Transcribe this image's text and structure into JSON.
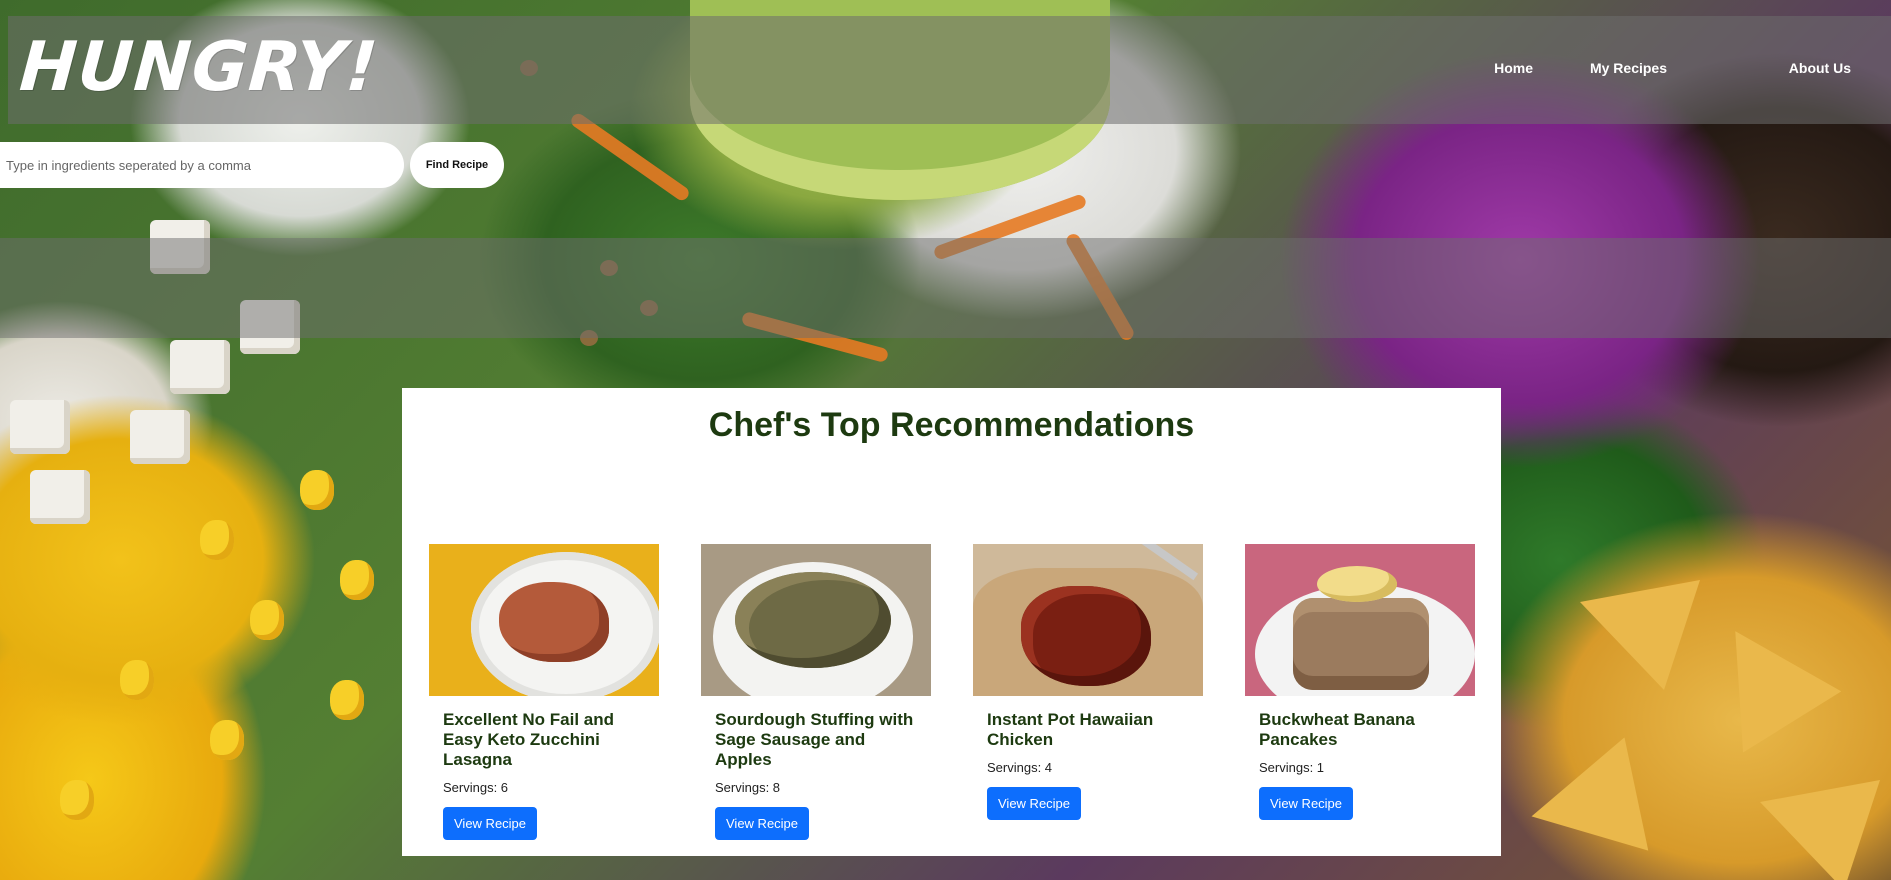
{
  "site": {
    "logo": "HUNGRY!"
  },
  "nav": {
    "items": [
      "Home",
      "My Recipes",
      "About Us"
    ]
  },
  "search": {
    "placeholder": "Type in ingredients seperated by a comma",
    "button_label": "Find Recipe"
  },
  "recommendations": {
    "title": "Chef's Top Recommendations",
    "cards": [
      {
        "title": "Excellent No Fail and Easy Keto Zucchini Lasagna",
        "servings": "Servings: 6",
        "button": "View Recipe",
        "image": "lasagna-plate-image"
      },
      {
        "title": "Sourdough Stuffing with Sage Sausage and Apples",
        "servings": "Servings: 8",
        "button": "View Recipe",
        "image": "stuffing-bowl-image"
      },
      {
        "title": "Instant Pot Hawaiian Chicken",
        "servings": "Servings: 4",
        "button": "View Recipe",
        "image": "hawaiian-chicken-image"
      },
      {
        "title": "Buckwheat Banana Pancakes",
        "servings": "Servings: 1",
        "button": "View Recipe",
        "image": "banana-pancakes-image"
      }
    ]
  },
  "colors": {
    "accent": "#0d6efd",
    "heading": "#1d3a10"
  }
}
